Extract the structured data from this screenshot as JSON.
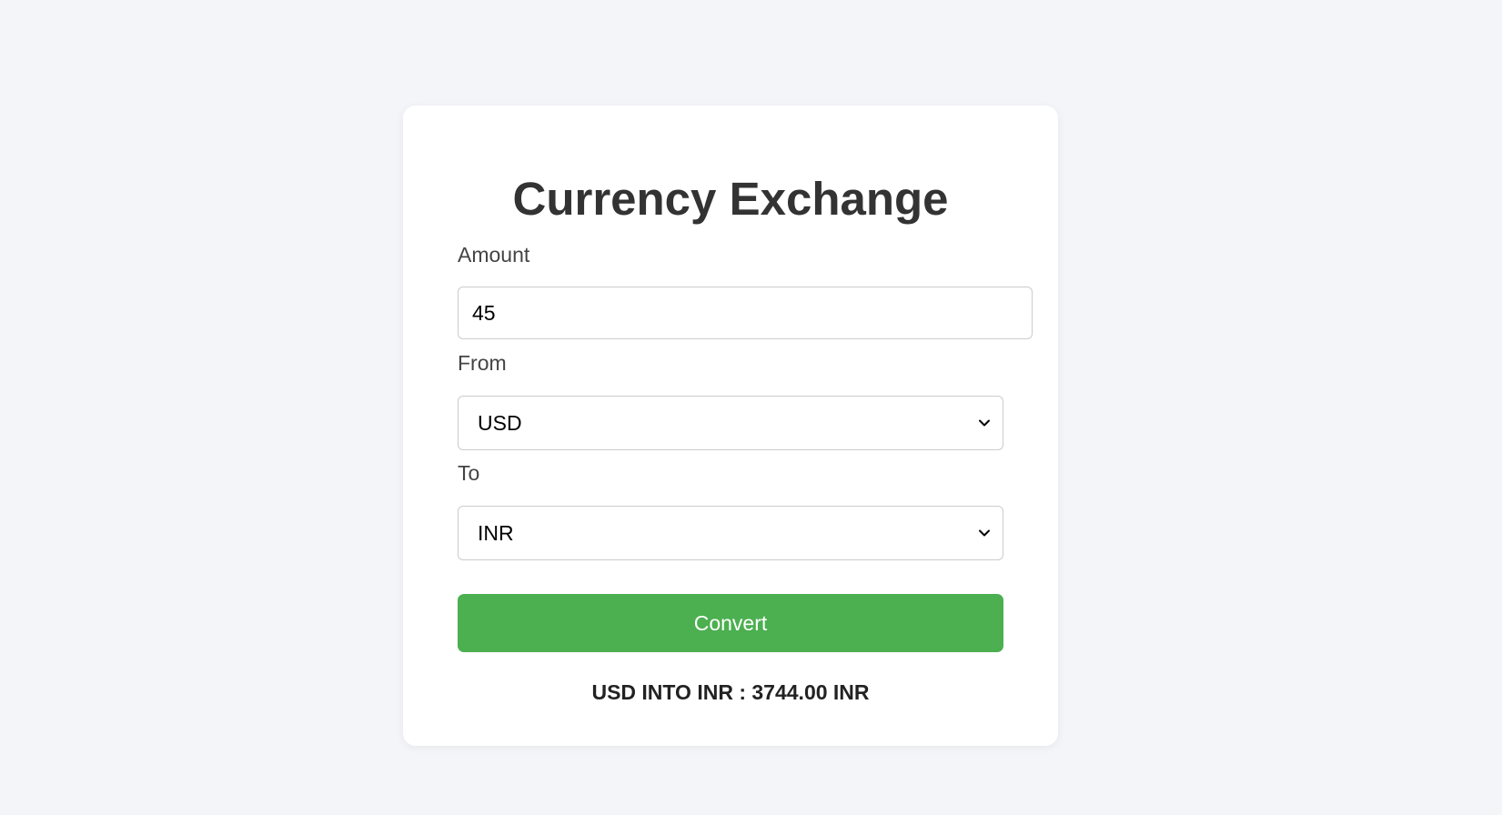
{
  "page": {
    "title": "Currency Exchange"
  },
  "form": {
    "amount_label": "Amount",
    "amount_value": "45",
    "from_label": "From",
    "from_value": "USD",
    "to_label": "To",
    "to_value": "INR",
    "convert_label": "Convert"
  },
  "result": {
    "text": "USD INTO INR : 3744.00 INR"
  },
  "colors": {
    "background": "#f4f5f9",
    "card": "#ffffff",
    "button": "#4caf50",
    "button_text": "#ffffff"
  },
  "icons": {
    "select_arrow": "chevron-down-icon"
  }
}
